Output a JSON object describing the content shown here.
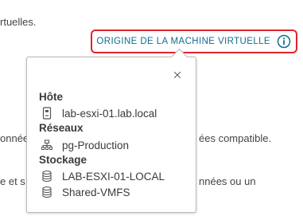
{
  "background": {
    "line1": "rtuelles.",
    "line2_left": "onnée",
    "line2_right": "ées compatible.",
    "line3_left": "e et s",
    "line3_right": "nnées ou un"
  },
  "origin_link": {
    "label": "ORIGINE DE LA MACHINE VIRTUELLE",
    "icon": "info-circle-icon",
    "highlight_color": "#e0242f",
    "text_color": "#0f6d8e"
  },
  "popover": {
    "close_icon": "close-icon",
    "host": {
      "title": "Hôte",
      "name": "lab-esxi-01.lab.local",
      "icon": "host-server-icon"
    },
    "networks": {
      "title": "Réseaux",
      "items": [
        {
          "name": "pg-Production",
          "icon": "network-icon"
        }
      ]
    },
    "storage": {
      "title": "Stockage",
      "items": [
        {
          "name": "LAB-ESXI-01-LOCAL",
          "icon": "datastore-icon"
        },
        {
          "name": "Shared-VMFS",
          "icon": "datastore-icon"
        }
      ]
    }
  }
}
